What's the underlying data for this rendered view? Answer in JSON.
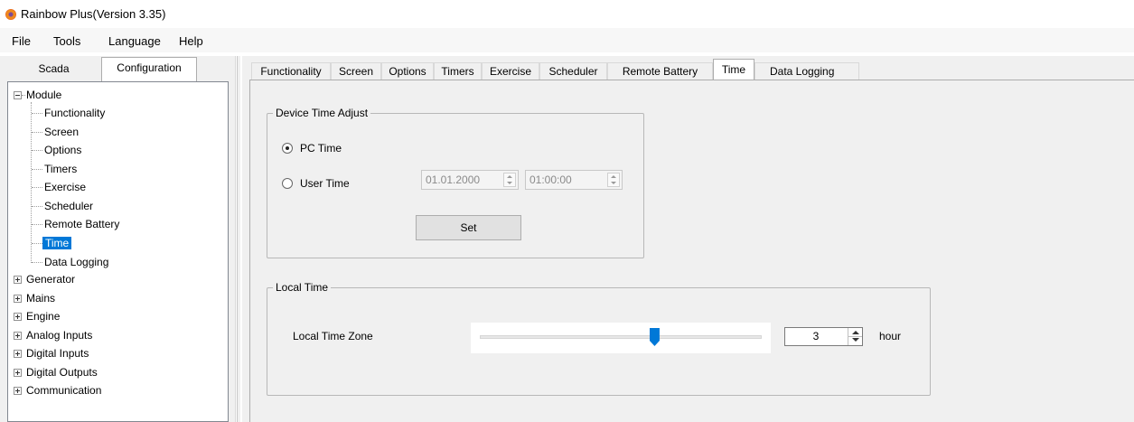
{
  "window": {
    "title": "Rainbow Plus(Version 3.35)",
    "icon": "app-logo-icon"
  },
  "menu": [
    "File",
    "Tools",
    "Language",
    "Help"
  ],
  "left_tabs": {
    "scada": "Scada",
    "configuration": "Configuration",
    "active": "configuration"
  },
  "tree": {
    "module": "Module",
    "module_children": [
      "Functionality",
      "Screen",
      "Options",
      "Timers",
      "Exercise",
      "Scheduler",
      "Remote Battery",
      "Time",
      "Data Logging"
    ],
    "selected": "Time",
    "top_nodes": [
      "Generator",
      "Mains",
      "Engine",
      "Analog Inputs",
      "Digital Inputs",
      "Digital Outputs",
      "Communication"
    ]
  },
  "tabs": [
    "Functionality",
    "Screen",
    "Options",
    "Timers",
    "Exercise",
    "Scheduler",
    "Remote Battery",
    "Time",
    "Data Logging"
  ],
  "active_tab": "Time",
  "device_time_adjust": {
    "title": "Device Time Adjust",
    "pc_time_label": "PC Time",
    "user_time_label": "User Time",
    "selected": "PC Time",
    "date_value": "01.01.2000",
    "time_value": "01:00:00",
    "set_button": "Set"
  },
  "local_time": {
    "title": "Local Time",
    "zone_label": "Local Time Zone",
    "slider_fraction": 0.62,
    "value": "3",
    "unit": "hour"
  },
  "colors": {
    "selection": "#0078d7",
    "slider_thumb": "#0078d7"
  }
}
